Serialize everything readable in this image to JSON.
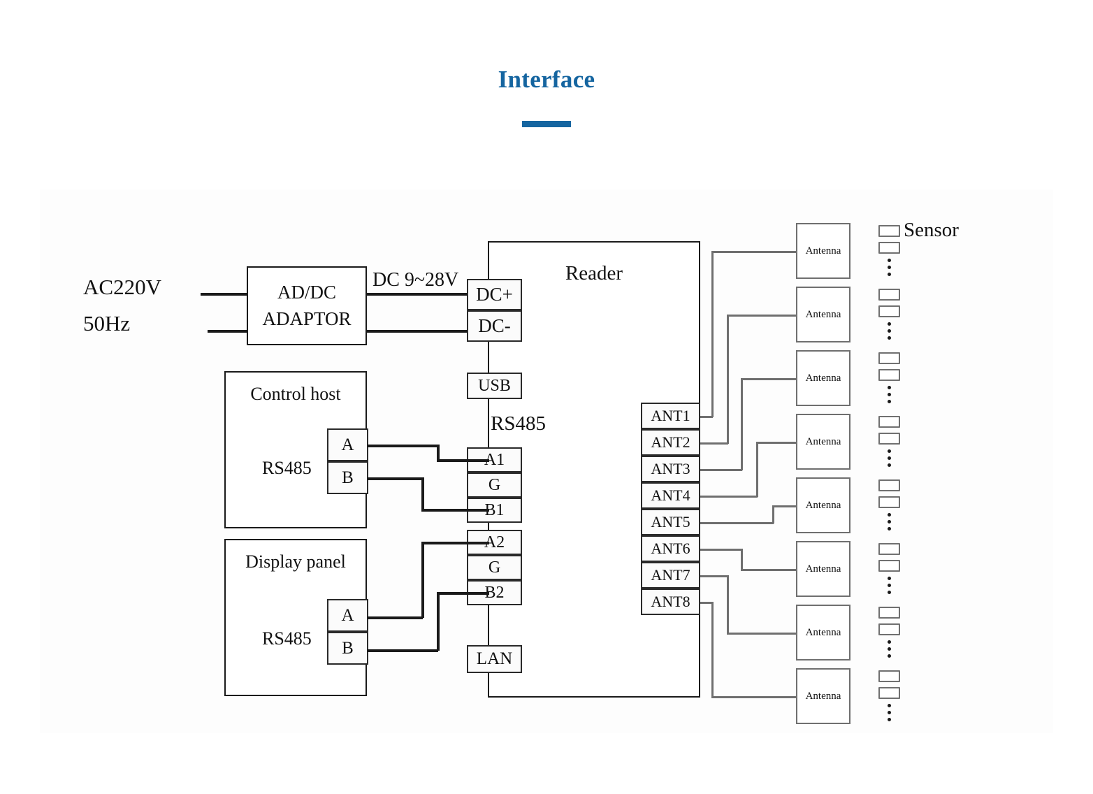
{
  "header": {
    "title": "Interface",
    "accent_color": "#1565a0"
  },
  "diagram": {
    "power": {
      "ac_label": "AC220V",
      "hz_label": "50Hz",
      "adaptor_line1": "AD/DC",
      "adaptor_line2": "ADAPTOR",
      "dc_range_label": "DC 9~28V"
    },
    "reader": {
      "title": "Reader",
      "rs485_label": "RS485",
      "power_terminals": [
        "DC+",
        "DC-"
      ],
      "usb_terminal": "USB",
      "rs485_group1": [
        "A1",
        "G",
        "B1"
      ],
      "rs485_group2": [
        "A2",
        "G",
        "B2"
      ],
      "lan_terminal": "LAN",
      "ant_ports": [
        "ANT1",
        "ANT2",
        "ANT3",
        "ANT4",
        "ANT5",
        "ANT6",
        "ANT7",
        "ANT8"
      ]
    },
    "control_host": {
      "title": "Control host",
      "bus_label": "RS485",
      "terminals": [
        "A",
        "B"
      ]
    },
    "display_panel": {
      "title": "Display panel",
      "bus_label": "RS485",
      "terminals": [
        "A",
        "B"
      ]
    },
    "antennas": [
      {
        "label": "Antenna"
      },
      {
        "label": "Antenna"
      },
      {
        "label": "Antenna"
      },
      {
        "label": "Antenna"
      },
      {
        "label": "Antenna"
      },
      {
        "label": "Antenna"
      },
      {
        "label": "Antenna"
      },
      {
        "label": "Antenna"
      }
    ],
    "sensor_column": {
      "label": "Sensor",
      "group_count": 8,
      "rects_per_group": 2,
      "dots_per_group": 3
    }
  }
}
